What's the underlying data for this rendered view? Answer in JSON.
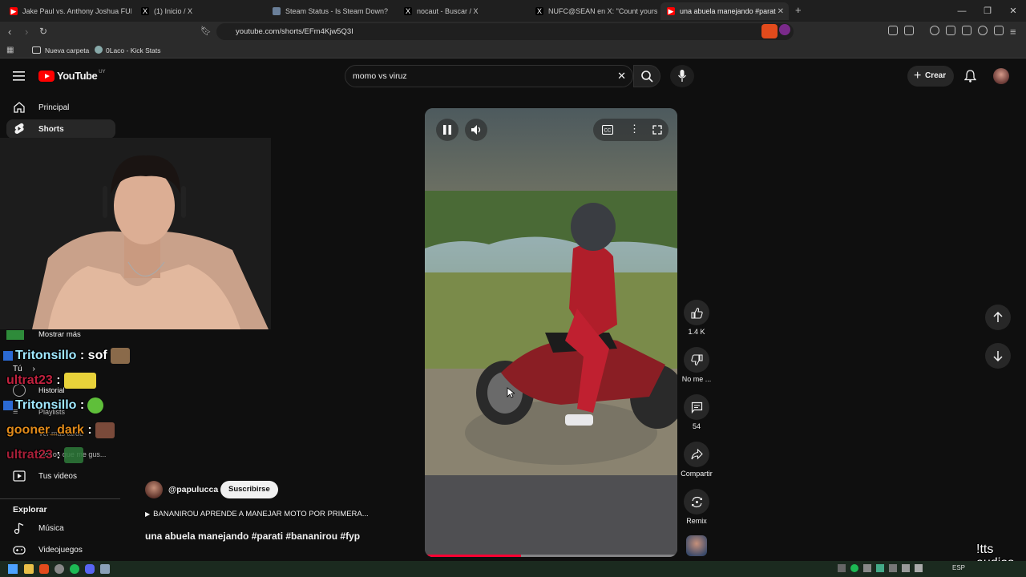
{
  "browser": {
    "tabs": [
      {
        "title": "Jake Paul vs. Anthony Joshua FULL H",
        "favicon": "youtube-icon",
        "color": "#ff0000"
      },
      {
        "title": "(1) Inicio / X",
        "favicon": "x-icon",
        "color": "#000000"
      },
      {
        "title": "Steam Status - Is Steam Down?",
        "favicon": "steam-icon",
        "color": "#6a7f99"
      },
      {
        "title": "nocaut - Buscar / X",
        "favicon": "x-icon",
        "color": "#000000"
      },
      {
        "title": "NUFC@SEAN en X: \"Count yourself l",
        "favicon": "x-icon",
        "color": "#000000"
      },
      {
        "title": "una abuela manejando #parat",
        "favicon": "youtube-icon",
        "color": "#ff0000",
        "active": true
      }
    ],
    "url": "youtube.com/shorts/EFm4Kjw5Q3I",
    "bookmarks": [
      "Nueva carpeta",
      "0Laco - Kick Stats"
    ]
  },
  "header": {
    "logo_text": "YouTube",
    "country": "UY",
    "search_value": "momo vs viruz",
    "create_label": "Crear"
  },
  "sidebar": {
    "items": [
      {
        "label": "Principal",
        "icon": "home-icon"
      },
      {
        "label": "Shorts",
        "icon": "shorts-icon",
        "selected": true
      }
    ],
    "you_section": {
      "show_more": "Mostrar más",
      "title": "Tú",
      "historial": "Historial",
      "playlists": "Playlists",
      "ver_mas_tarde": "Ver más tarde",
      "videos_que_me_gustan": "Videos que me gus...",
      "tus_videos": "Tus videos"
    },
    "explore_title": "Explorar",
    "explore_items": [
      {
        "label": "Música",
        "icon": "music-icon"
      },
      {
        "label": "Videojuegos",
        "icon": "gamepad-icon"
      }
    ]
  },
  "chat": [
    {
      "user": "Tritonsillo",
      "text": " : sof",
      "color": "#9fe8ff",
      "badge": true
    },
    {
      "user": "ultrat23",
      "text": " :",
      "color": "#c0213e",
      "badge": false
    },
    {
      "user": "Tritonsillo",
      "text": " :",
      "color": "#9fe8ff",
      "badge": true
    },
    {
      "user": "gooner_dark",
      "text": " :",
      "color": "#e08a1a",
      "badge": false
    },
    {
      "user": "ultrat23",
      "text": " :",
      "color": "#c0213e",
      "badge": false
    }
  ],
  "short": {
    "channel": "@papulucca",
    "subscribe_label": "Suscribirse",
    "playlist_label": "BANANIROU APRENDE A MANEJAR MOTO POR PRIMERA...",
    "title": "una abuela manejando #parati #bananirou #fyp",
    "progress": 0.38,
    "actions": {
      "likes": "1.4 K",
      "dislike_label": "No me ...",
      "comments": "54",
      "share_label": "Compartir",
      "remix_label": "Remix"
    }
  },
  "overlay_watermark": "!tts\naudios",
  "taskbar": {
    "language": "ESP"
  }
}
